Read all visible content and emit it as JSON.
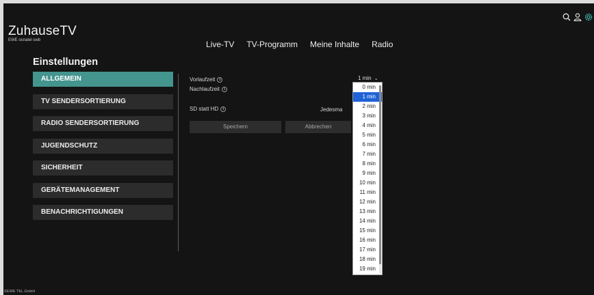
{
  "header": {
    "logo_text": "ZuhauseTV",
    "logo_sub": "EWE osnatel swb",
    "nav": [
      "Live-TV",
      "TV-Programm",
      "Meine Inhalte",
      "Radio"
    ]
  },
  "page_title": "Einstellungen",
  "sidebar": {
    "items": [
      {
        "label": "ALLGEMEIN",
        "active": true
      },
      {
        "label": "TV SENDERSORTIERUNG",
        "active": false
      },
      {
        "label": "RADIO SENDERSORTIERUNG",
        "active": false
      },
      {
        "label": "JUGENDSCHUTZ",
        "active": false
      },
      {
        "label": "SICHERHEIT",
        "active": false
      },
      {
        "label": "GERÄTEMANAGEMENT",
        "active": false
      },
      {
        "label": "BENACHRICHTIGUNGEN",
        "active": false
      }
    ]
  },
  "settings": {
    "vorlaufzeit_label": "Vorlaufzeit",
    "vorlaufzeit_value": "1 min",
    "nachlaufzeit_label": "Nachlaufzeit",
    "sd_label": "SD statt HD",
    "sd_value": "Jedesma",
    "save_label": "Speichern",
    "cancel_label": "Abbrechen"
  },
  "dropdown": {
    "selected": "1 min",
    "options": [
      "0 min",
      "1 min",
      "2 min",
      "3 min",
      "4 min",
      "5 min",
      "6 min",
      "7 min",
      "8 min",
      "9 min",
      "10 min",
      "11 min",
      "12 min",
      "13 min",
      "14 min",
      "15 min",
      "16 min",
      "17 min",
      "18 min",
      "19 min"
    ]
  },
  "footer": "©EWE TEL GmbH",
  "colors": {
    "accent": "#45958f",
    "background": "#141414",
    "selected_option": "#1f63d6"
  },
  "icons": [
    "search-icon",
    "user-icon",
    "gear-icon",
    "info-icon",
    "chevron-down-icon"
  ]
}
